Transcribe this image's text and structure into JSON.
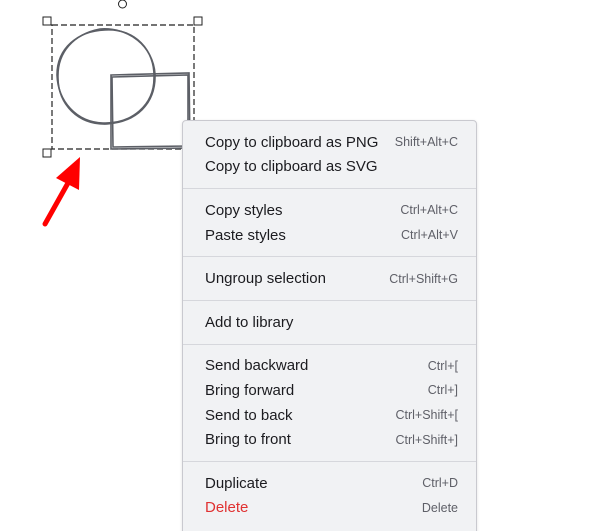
{
  "menu": {
    "copy_png": {
      "label": "Copy to clipboard as PNG",
      "shortcut": "Shift+Alt+C"
    },
    "copy_svg": {
      "label": "Copy to clipboard as SVG",
      "shortcut": ""
    },
    "copy_styles": {
      "label": "Copy styles",
      "shortcut": "Ctrl+Alt+C"
    },
    "paste_styles": {
      "label": "Paste styles",
      "shortcut": "Ctrl+Alt+V"
    },
    "ungroup": {
      "label": "Ungroup selection",
      "shortcut": "Ctrl+Shift+G"
    },
    "add_library": {
      "label": "Add to library",
      "shortcut": ""
    },
    "send_backward": {
      "label": "Send backward",
      "shortcut": "Ctrl+["
    },
    "bring_forward": {
      "label": "Bring forward",
      "shortcut": "Ctrl+]"
    },
    "send_to_back": {
      "label": "Send to back",
      "shortcut": "Ctrl+Shift+["
    },
    "bring_to_front": {
      "label": "Bring to front",
      "shortcut": "Ctrl+Shift+]"
    },
    "duplicate": {
      "label": "Duplicate",
      "shortcut": "Ctrl+D"
    },
    "delete": {
      "label": "Delete",
      "shortcut": "Delete"
    }
  },
  "colors": {
    "arrow": "#ff0000",
    "danger": "#e03131",
    "stroke": "#5c5f66"
  },
  "icons": {
    "pointer": "red-arrow-icon"
  }
}
